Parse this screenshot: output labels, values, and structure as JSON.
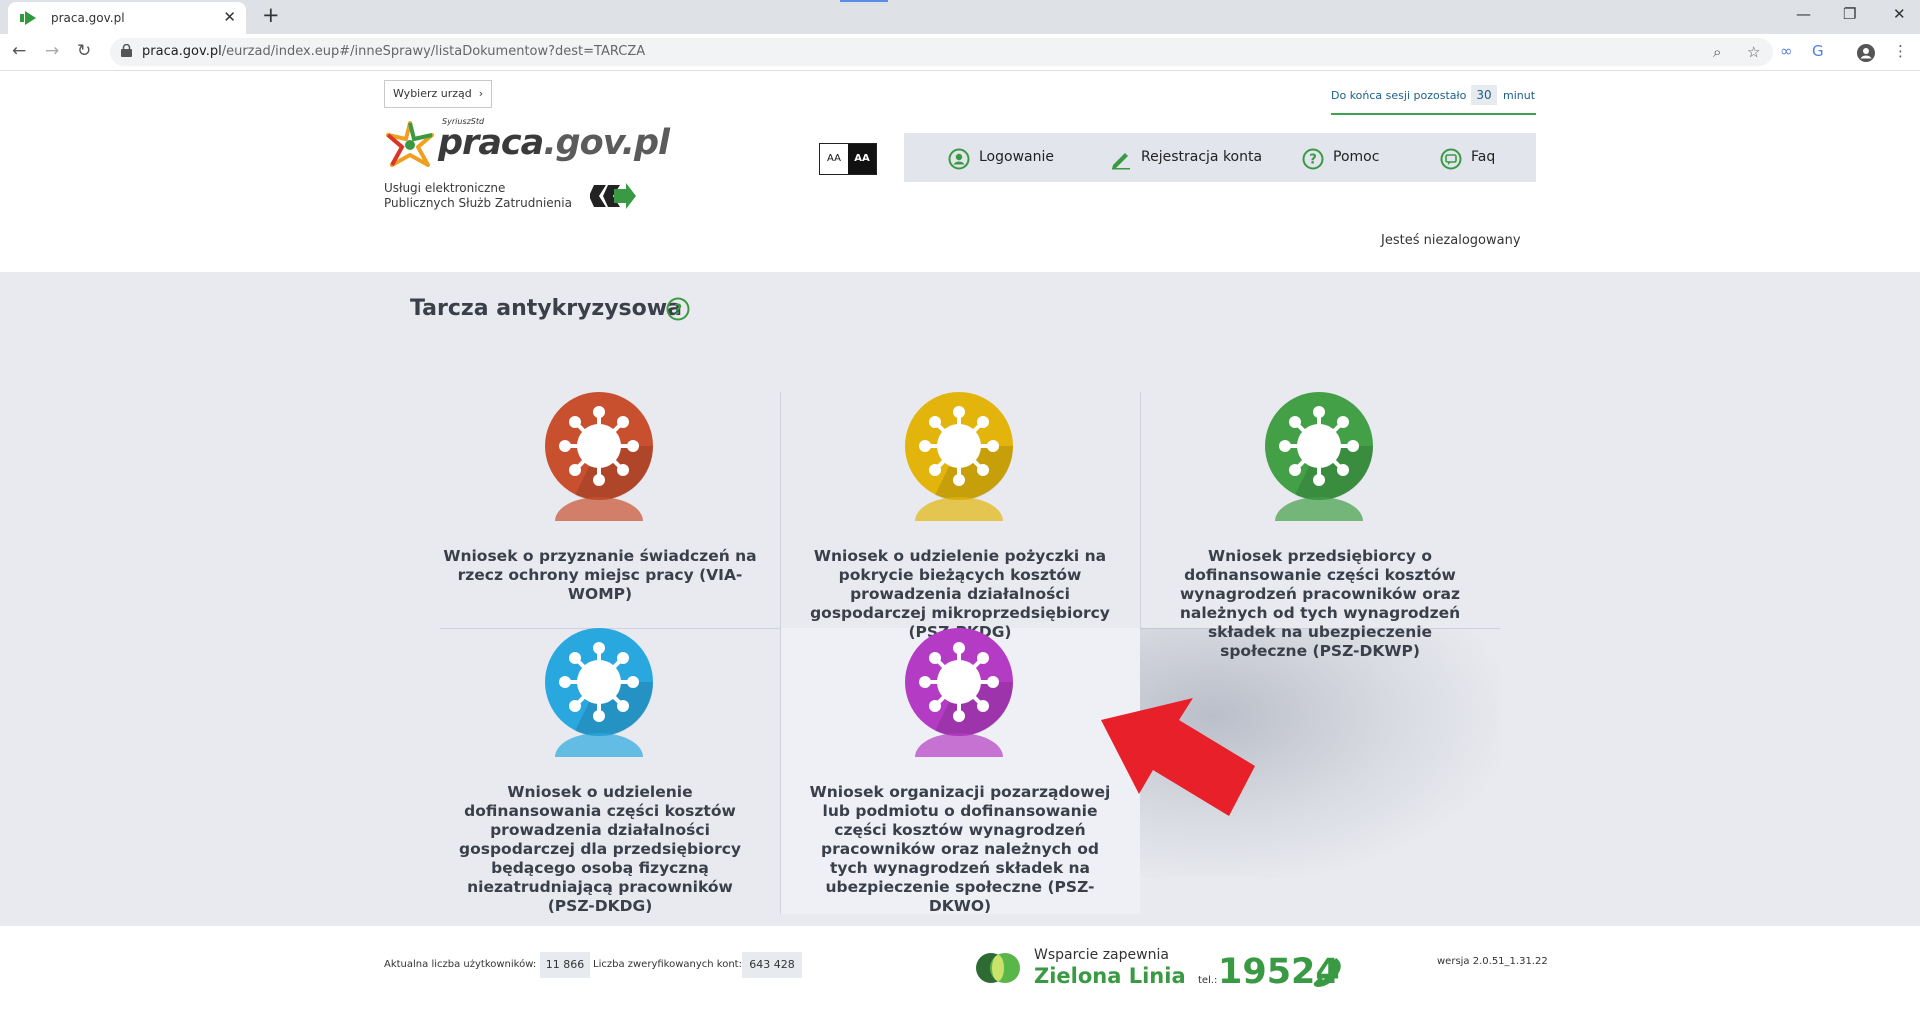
{
  "browser": {
    "tab_title": "praca.gov.pl",
    "url_host": "praca.gov.pl",
    "url_path": "/eurzad/index.eup#/inneSprawy/listaDokumentow?dest=TARCZA"
  },
  "header": {
    "office_button": "Wybierz urząd",
    "logo_super": "SyriuszStd",
    "logo_main": "praca",
    "logo_domain": ".gov.pl",
    "logo_sub_line1": "Usługi elektroniczne",
    "logo_sub_line2": "Publicznych Służb Zatrudnienia",
    "font_small": "AA",
    "font_large": "AA",
    "session_label": "Do końca sesji pozostało",
    "session_minutes": "30",
    "session_unit": "minut",
    "nav": {
      "login": "Logowanie",
      "register": "Rejestracja konta",
      "help": "Pomoc",
      "faq": "Faq"
    },
    "login_status": "Jesteś niezalogowany"
  },
  "main": {
    "title": "Tarcza antykryzysowa",
    "tiles": [
      {
        "label": "Wniosek o przyznanie świadczeń na rzecz ochrony miejsc pracy (VIA-WOMP)",
        "color": "#c9502f"
      },
      {
        "label": "Wniosek o udzielenie pożyczki na pokrycie bieżących kosztów prowadzenia działalności gospodarczej mikroprzedsiębiorcy (PSZ-PKDG)",
        "color": "#e3b50c"
      },
      {
        "label": "Wniosek przedsiębiorcy o dofinansowanie części kosztów wynagrodzeń pracowników oraz należnych od tych wynagrodzeń składek na ubezpieczenie społeczne (PSZ-DKWP)",
        "color": "#43a047"
      },
      {
        "label": "Wniosek o udzielenie dofinansowania części kosztów prowadzenia działalności gospodarczej dla przedsiębiorcy będącego osobą fizyczną niezatrudniającą pracowników (PSZ-DKDG)",
        "color": "#29a8e0"
      },
      {
        "label": "Wniosek organizacji pozarządowej lub podmiotu o dofinansowanie części kosztów wynagrodzeń pracowników oraz należnych od tych wynagrodzeń składek na ubezpieczenie społeczne (PSZ-DKWO)",
        "color": "#b43cc4"
      }
    ]
  },
  "footer": {
    "users_label": "Aktualna liczba użytkowników:",
    "users_count": "11 866",
    "verified_label": "Liczba zweryfikowanych kont:",
    "verified_count": "643 428",
    "support_line1": "Wsparcie zapewnia",
    "support_line2": "Zielona Linia",
    "tel_label": "tel.:",
    "tel_number": "19524",
    "version": "wersja 2.0.51_1.31.22"
  },
  "colors": {
    "accent_green": "#3a9a43",
    "annotation_arrow": "#e8202a"
  }
}
